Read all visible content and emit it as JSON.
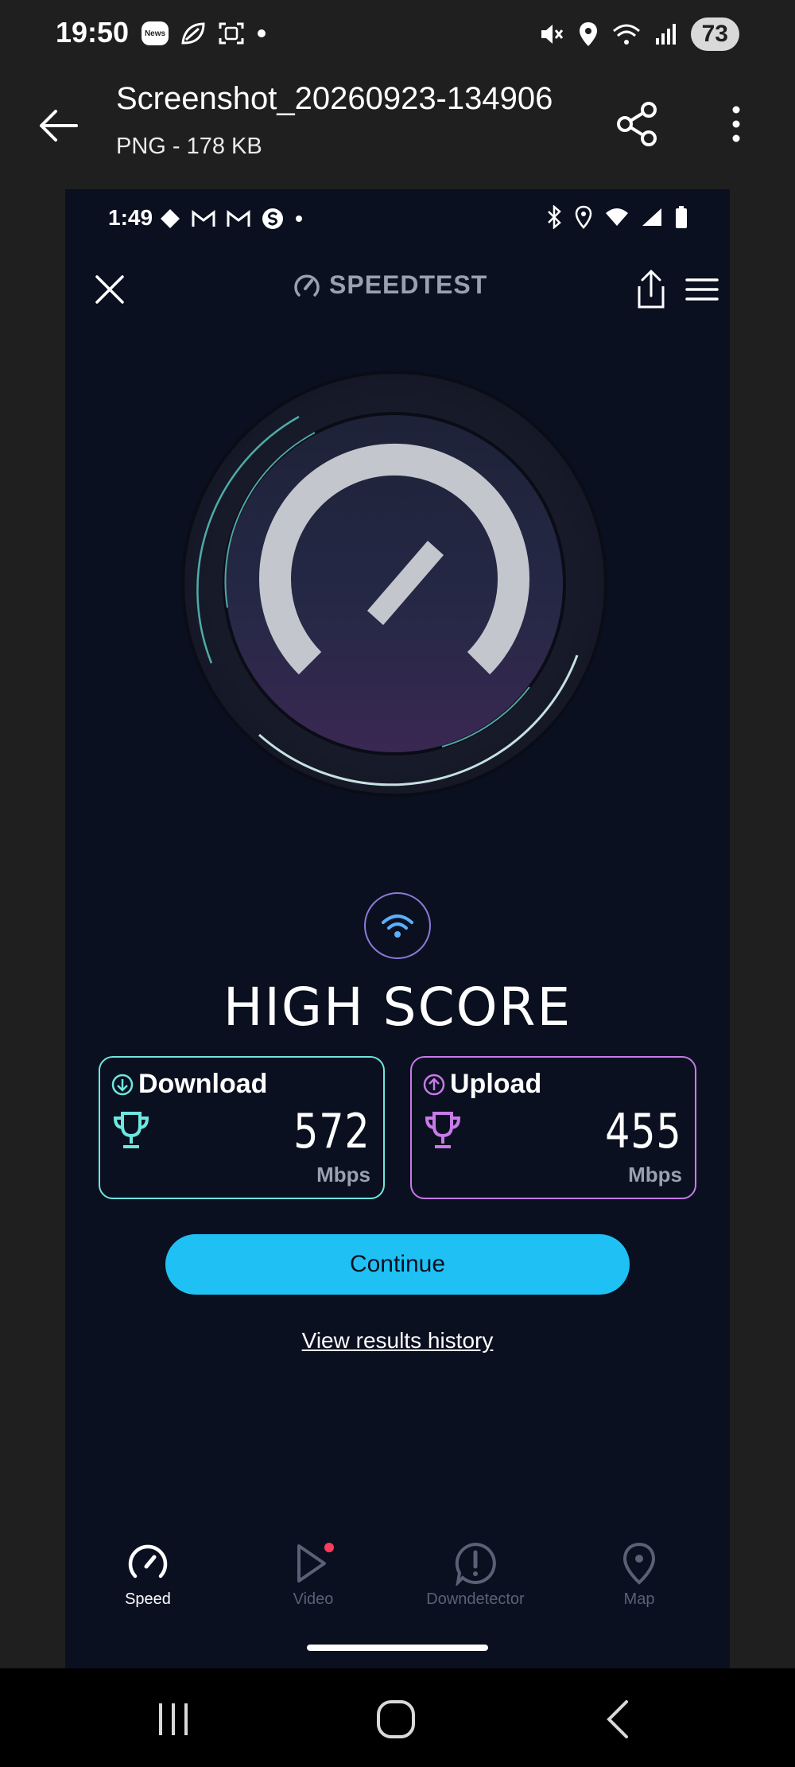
{
  "outer_status": {
    "time": "19:50",
    "news_label": "News",
    "battery": "73"
  },
  "viewer": {
    "title": "Screenshot_20260923-134906",
    "meta": "PNG - 178 KB"
  },
  "inner_status": {
    "time": "1:49"
  },
  "app": {
    "brand": "SPEEDTEST",
    "headline": "HIGH SCORE",
    "download": {
      "label": "Download",
      "value": "572",
      "unit": "Mbps",
      "accent": "#6ee7df"
    },
    "upload": {
      "label": "Upload",
      "value": "455",
      "unit": "Mbps",
      "accent": "#c77ae8"
    },
    "continue_label": "Continue",
    "history_label": "View results history",
    "button_color": "#1fc1f5"
  },
  "nav": {
    "items": [
      {
        "label": "Speed",
        "icon": "gauge-icon",
        "active": true
      },
      {
        "label": "Video",
        "icon": "play-icon",
        "active": false
      },
      {
        "label": "Downdetector",
        "icon": "alert-icon",
        "active": false
      },
      {
        "label": "Map",
        "icon": "map-pin-icon",
        "active": false
      }
    ]
  }
}
